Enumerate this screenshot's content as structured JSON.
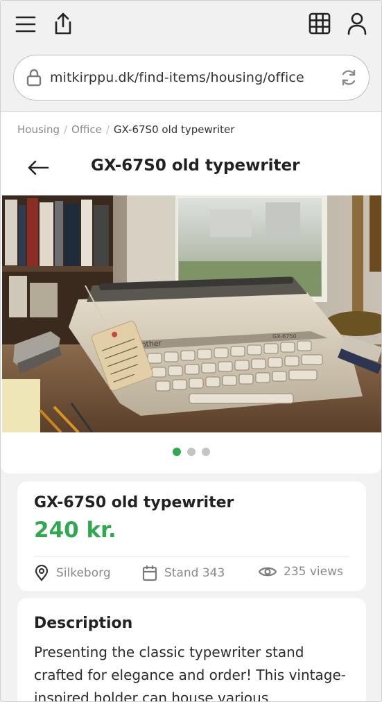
{
  "browser": {
    "url": "mitkirppu.dk/find-items/housing/office",
    "icons": {
      "menu": "menu-icon",
      "share": "share-icon",
      "grid": "grid-icon",
      "account": "user-icon",
      "lock": "lock-icon",
      "reload": "reload-icon"
    }
  },
  "breadcrumb": {
    "items": [
      "Housing",
      "Office",
      "GX-67S0 old typewriter"
    ],
    "separator": "/"
  },
  "header": {
    "title": "GX-67S0 old typewriter",
    "back_icon": "arrow-left-icon"
  },
  "gallery": {
    "image_alt": "Vintage typewriter on a desk with a price tag",
    "pages": 3,
    "active_index": 0,
    "photo_labels": {
      "brand": "brother",
      "model": "GX-6750",
      "tag": "Brother GX-6750 Typewriter Office use 135 DKK"
    }
  },
  "listing": {
    "title": "GX-67S0 old typewriter",
    "price": "240 kr.",
    "location": "Silkeborg",
    "stand": "Stand 343",
    "views": "235 views"
  },
  "description": {
    "heading": "Description",
    "text": "Presenting the classic typewriter stand crafted for elegance and order! This vintage-inspired holder can house various"
  },
  "colors": {
    "accent": "#2fa84f",
    "text": "#222222",
    "muted": "#8a8a8a",
    "background": "#f2f2f2"
  }
}
